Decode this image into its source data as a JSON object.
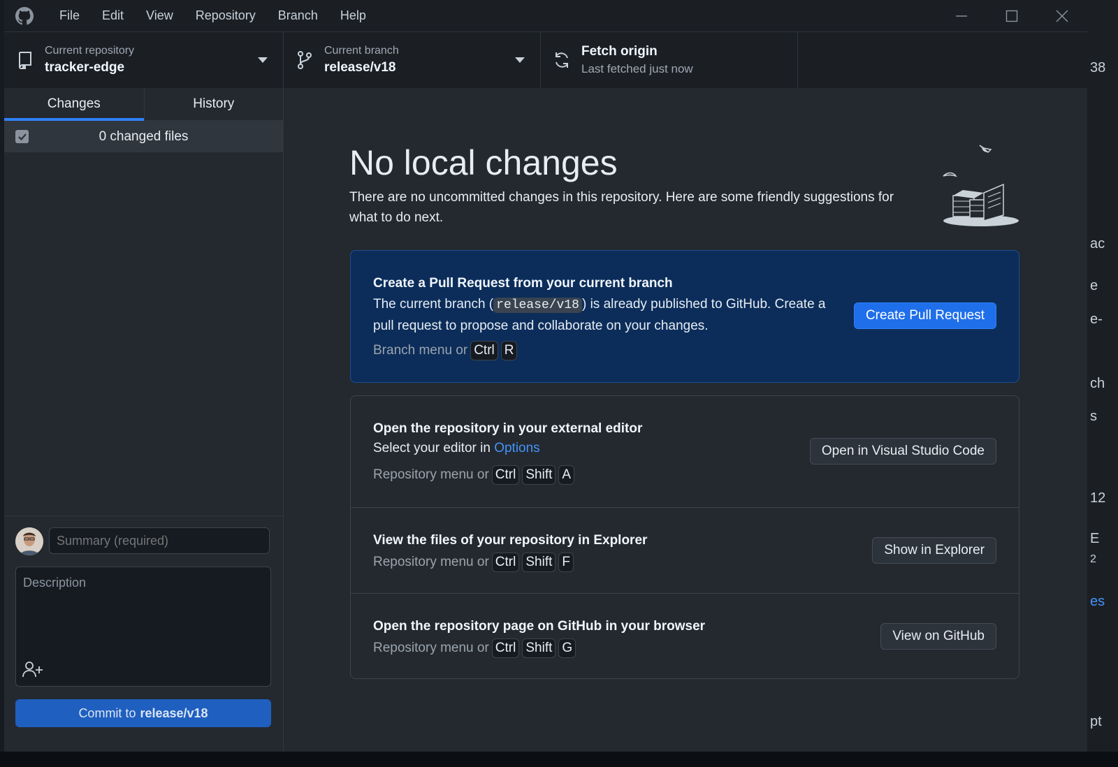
{
  "menu": [
    "File",
    "Edit",
    "View",
    "Repository",
    "Branch",
    "Help"
  ],
  "toolbar": {
    "repo_label": "Current repository",
    "repo_name": "tracker-edge",
    "branch_label": "Current branch",
    "branch_name": "release/v18",
    "fetch_title": "Fetch origin",
    "fetch_status": "Last fetched just now"
  },
  "sidebar": {
    "tabs": [
      "Changes",
      "History"
    ],
    "active_tab": "Changes",
    "changed_files": "0 changed files",
    "summary_placeholder": "Summary (required)",
    "description_placeholder": "Description",
    "commit_prefix": "Commit to",
    "commit_branch": "release/v18"
  },
  "main": {
    "title": "No local changes",
    "description": "There are no uncommitted changes in this repository. Here are some friendly suggestions for what to do next.",
    "pr_card": {
      "title": "Create a Pull Request from your current branch",
      "text_before": "The current branch (",
      "branch": "release/v18",
      "text_after": ") is already published to GitHub. Create a",
      "text_line2": "pull request to propose and collaborate on your changes.",
      "hint": "Branch menu or",
      "keys": [
        "Ctrl",
        "R"
      ],
      "button": "Create Pull Request"
    },
    "editor_card": {
      "title": "Open the repository in your external editor",
      "text": "Select your editor in",
      "link": "Options",
      "hint": "Repository menu or",
      "keys": [
        "Ctrl",
        "Shift",
        "A"
      ],
      "button": "Open in Visual Studio Code"
    },
    "explorer_card": {
      "title": "View the files of your repository in Explorer",
      "hint": "Repository menu or",
      "keys": [
        "Ctrl",
        "Shift",
        "F"
      ],
      "button": "Show in Explorer"
    },
    "github_card": {
      "title": "Open the repository page on GitHub in your browser",
      "hint": "Repository menu or",
      "keys": [
        "Ctrl",
        "Shift",
        "G"
      ],
      "button": "View on GitHub"
    }
  },
  "background_fragments": [
    "38",
    "ac",
    "e",
    "e-",
    "ch",
    "s",
    "12",
    "E",
    "2",
    "es",
    "pt"
  ],
  "colors": {
    "accent": "#1f6feb",
    "pr_card_bg": "#0c2d5a",
    "link": "#4493f8",
    "app_bg": "#24292f",
    "chrome_bg": "#1b1f24"
  },
  "icons": [
    "github-logo-icon",
    "repository-icon",
    "branch-icon",
    "sync-icon",
    "caret-down-icon",
    "checkbox-checked-icon",
    "add-coauthor-icon",
    "minimize-icon",
    "maximize-icon",
    "close-icon",
    "empty-state-illustration"
  ]
}
